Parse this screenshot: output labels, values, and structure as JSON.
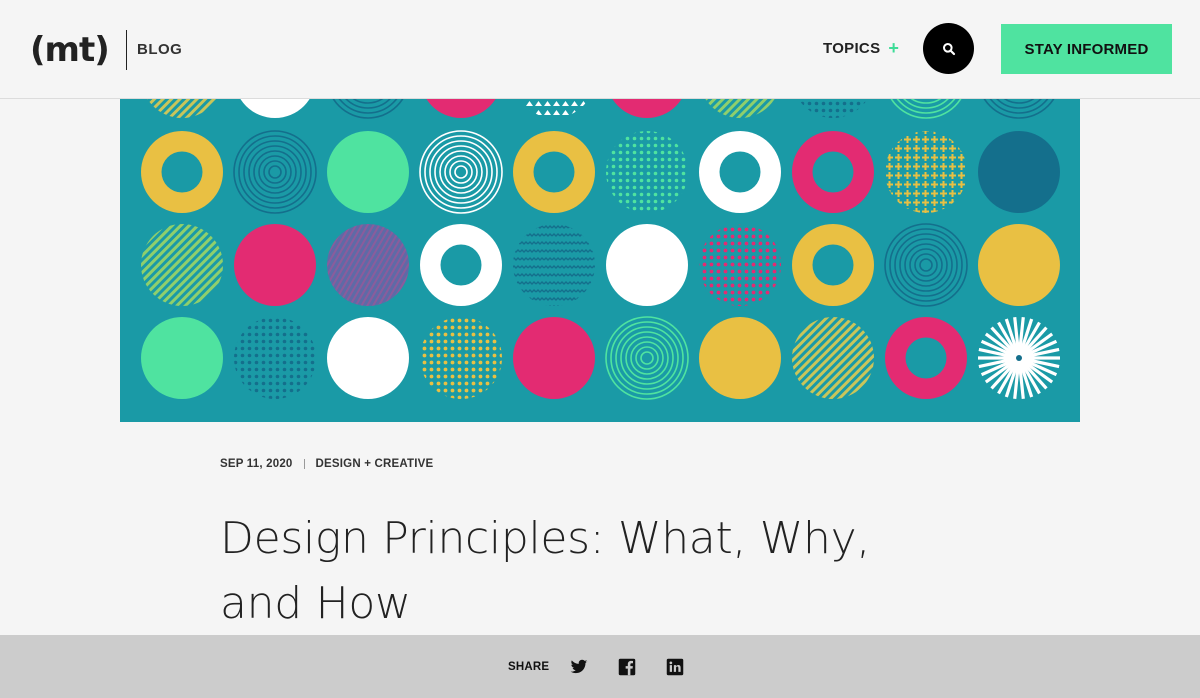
{
  "header": {
    "logo_text": "(mt)",
    "section_label": "BLOG",
    "topics_label": "TOPICS",
    "topics_icon": "+",
    "search_icon": "search-icon",
    "cta_label": "STAY INFORMED",
    "accent_color": "#4fe3a0"
  },
  "hero": {
    "background_color": "#1a9aa6",
    "palette": {
      "yellow": "#e9c043",
      "pink": "#e32b72",
      "green": "#4fe3a0",
      "white": "#ffffff",
      "dark_teal": "#146f8c",
      "purple": "#6a6aa8"
    }
  },
  "article": {
    "date": "SEP 11, 2020",
    "category": "DESIGN + CREATIVE",
    "title": "Design Principles: What, Why, and How"
  },
  "share": {
    "label": "SHARE",
    "icons": [
      "twitter-icon",
      "facebook-icon",
      "linkedin-icon"
    ]
  }
}
